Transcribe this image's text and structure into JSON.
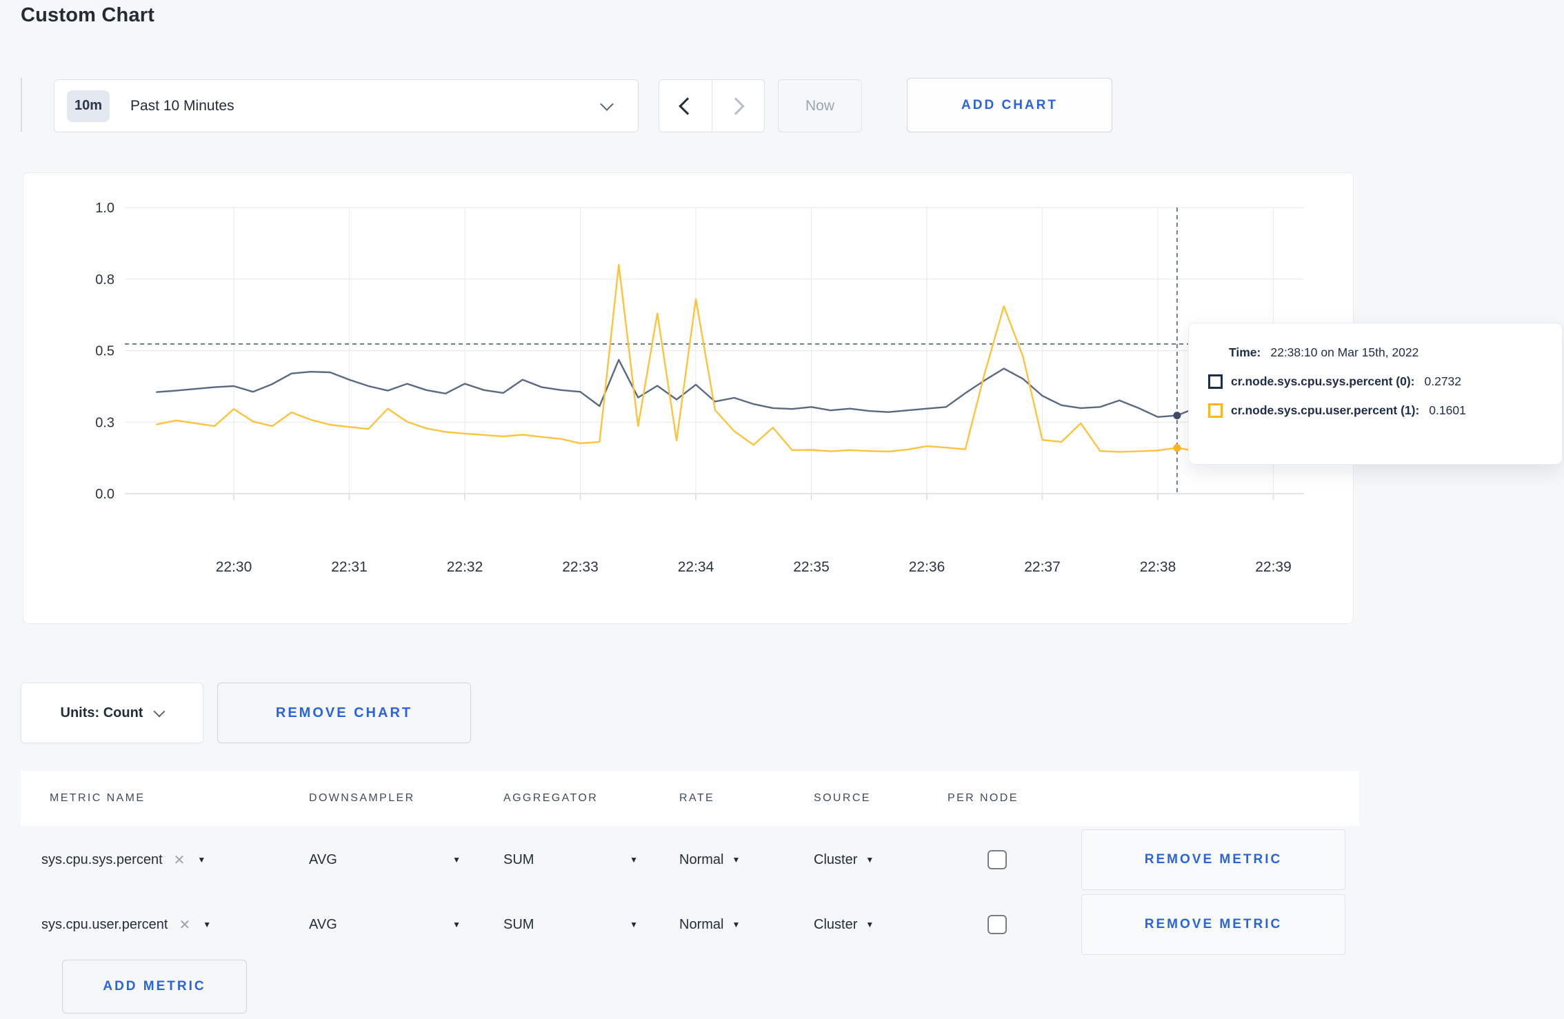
{
  "page": {
    "title": "Custom Chart"
  },
  "toolbar": {
    "timescale": {
      "badge": "10m",
      "label": "Past 10 Minutes"
    },
    "now_label": "Now",
    "add_chart_label": "ADD CHART"
  },
  "icons": {
    "caret_down": "▼",
    "clear": "✕"
  },
  "tooltip": {
    "time_label": "Time:",
    "time_value": "22:38:10 on Mar 15th, 2022",
    "rows": [
      {
        "label": "cr.node.sys.cpu.sys.percent (0):",
        "value": "0.2732",
        "swatch_color": "#1c2c4c"
      },
      {
        "label": "cr.node.sys.cpu.user.percent (1):",
        "value": "0.1601",
        "swatch_color": "#fcb71d"
      }
    ]
  },
  "chart_footer": {
    "units_label": "Units: Count",
    "remove_chart_label": "REMOVE CHART"
  },
  "metrics_table": {
    "headers": [
      "METRIC NAME",
      "DOWNSAMPLER",
      "AGGREGATOR",
      "RATE",
      "SOURCE",
      "PER NODE"
    ],
    "rows": [
      {
        "metric": "sys.cpu.sys.percent",
        "downsampler": "AVG",
        "aggregator": "SUM",
        "rate": "Normal",
        "source": "Cluster",
        "per_node_checked": false,
        "remove_label": "REMOVE METRIC"
      },
      {
        "metric": "sys.cpu.user.percent",
        "downsampler": "AVG",
        "aggregator": "SUM",
        "rate": "Normal",
        "source": "Cluster",
        "per_node_checked": false,
        "remove_label": "REMOVE METRIC"
      }
    ],
    "add_metric_label": "ADD METRIC"
  },
  "colors": {
    "accent_blue": "#2a63da",
    "crosshair": "#4e6377",
    "grid": "#e9ebf0",
    "axis": "#d9dee5",
    "tick_text": "#2b3442"
  },
  "chart_data": {
    "type": "line",
    "title": "",
    "xlabel": "",
    "ylabel": "",
    "ylim": [
      0,
      1
    ],
    "grid": true,
    "legend": "tooltip-only",
    "x_start": "22:29:20",
    "x_interval_seconds": 10,
    "x_tick_labels": [
      "22:30",
      "22:31",
      "22:32",
      "22:33",
      "22:34",
      "22:35",
      "22:36",
      "22:37",
      "22:38",
      "22:39"
    ],
    "y_ticks": [
      {
        "value": 0,
        "label": "0.0"
      },
      {
        "value": 0.25,
        "label": "0.3"
      },
      {
        "value": 0.5,
        "label": "0.5"
      },
      {
        "value": 0.75,
        "label": "0.8"
      },
      {
        "value": 1,
        "label": "1.0"
      }
    ],
    "series": [
      {
        "name": "cr.node.sys.cpu.sys.percent (0)",
        "color": "#5a6882",
        "values": [
          0.355,
          0.36,
          0.366,
          0.372,
          0.376,
          0.356,
          0.383,
          0.42,
          0.426,
          0.424,
          0.398,
          0.376,
          0.36,
          0.384,
          0.362,
          0.35,
          0.384,
          0.362,
          0.352,
          0.398,
          0.372,
          0.362,
          0.356,
          0.306,
          0.468,
          0.336,
          0.377,
          0.329,
          0.381,
          0.322,
          0.335,
          0.313,
          0.299,
          0.296,
          0.303,
          0.291,
          0.297,
          0.289,
          0.285,
          0.291,
          0.297,
          0.303,
          0.351,
          0.396,
          0.437,
          0.401,
          0.342,
          0.309,
          0.299,
          0.303,
          0.326,
          0.299,
          0.268,
          0.2732,
          0.3,
          0.296,
          0.301,
          0.298,
          0.302
        ]
      },
      {
        "name": "cr.node.sys.cpu.user.percent (1)",
        "color": "#fcc43d",
        "values": [
          0.242,
          0.256,
          0.246,
          0.236,
          0.296,
          0.252,
          0.236,
          0.284,
          0.258,
          0.241,
          0.233,
          0.226,
          0.297,
          0.251,
          0.228,
          0.216,
          0.21,
          0.205,
          0.2,
          0.206,
          0.198,
          0.191,
          0.176,
          0.181,
          0.8,
          0.236,
          0.63,
          0.186,
          0.68,
          0.292,
          0.218,
          0.17,
          0.231,
          0.152,
          0.153,
          0.148,
          0.152,
          0.149,
          0.147,
          0.154,
          0.166,
          0.161,
          0.155,
          0.42,
          0.655,
          0.478,
          0.188,
          0.181,
          0.246,
          0.149,
          0.146,
          0.148,
          0.151,
          0.1601,
          0.149,
          0.152,
          0.228,
          0.268,
          0.221
        ]
      }
    ],
    "crosshair": {
      "time": "22:38:10",
      "y_value": 0.523
    },
    "highlight_points": [
      {
        "series": 0,
        "time": "22:38:10",
        "value": 0.2732,
        "color": "#3f4c68"
      },
      {
        "series": 1,
        "time": "22:38:10",
        "value": 0.1601,
        "color": "#fcb825"
      }
    ]
  }
}
